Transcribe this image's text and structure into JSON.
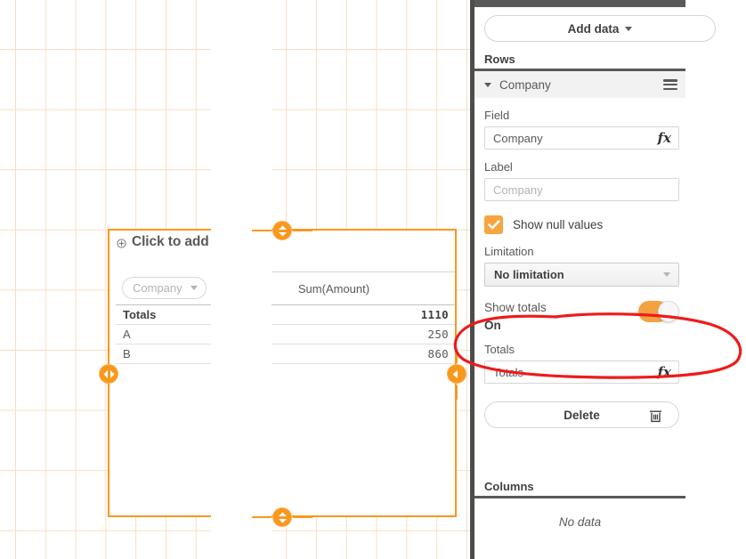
{
  "canvas": {
    "chart": {
      "title_placeholder": "Click to add title",
      "add_title_icon": "plus-circle-icon",
      "table": {
        "dimension_pill_label": "Company",
        "dimension_pill_icon": "chevron-down-icon",
        "measure_header": "Sum(Amount)",
        "totals_row": {
          "label": "Totals",
          "value": "1110"
        },
        "rows": [
          {
            "label": "A",
            "value": "250"
          },
          {
            "label": "B",
            "value": "860"
          }
        ]
      }
    },
    "handles": {
      "top": "resize-handle-top",
      "bottom": "resize-handle-bottom",
      "left": "resize-handle-left",
      "right": "resize-handle-right"
    }
  },
  "panel": {
    "add_data": {
      "label": "Add data",
      "icon": "chevron-down-icon"
    },
    "rows_section": {
      "header": "Rows",
      "accordion": {
        "label": "Company",
        "caret_icon": "chevron-down-icon",
        "menu_icon": "burger-menu-icon"
      },
      "field": {
        "label": "Field",
        "value": "Company",
        "fx_icon": "fx-icon"
      },
      "label_field": {
        "label": "Label",
        "placeholder": "Company"
      },
      "show_null": {
        "label": "Show null values",
        "checked": true,
        "icon": "check-icon"
      },
      "limitation": {
        "label": "Limitation",
        "value": "No limitation",
        "icon": "chevron-down-icon"
      },
      "show_totals": {
        "label": "Show totals",
        "state": "On",
        "enabled": true
      },
      "totals": {
        "label": "Totals",
        "value": "Totals",
        "fx_icon": "fx-icon"
      },
      "delete": {
        "label": "Delete",
        "icon": "trash-icon"
      }
    },
    "columns_section": {
      "header": "Columns",
      "empty_text": "No data"
    }
  },
  "annotation": {
    "shape": "red-ellipse-highlight",
    "color": "#ee1b1b",
    "target": "show-totals-toggle"
  },
  "colors": {
    "accent_orange": "#f8981d",
    "toggle_orange": "#f4a142",
    "checkbox_orange": "#f6a641",
    "grid_line": "#fbdcc0",
    "panel_dark": "#595959",
    "annotation_red": "#ee1b1b"
  }
}
